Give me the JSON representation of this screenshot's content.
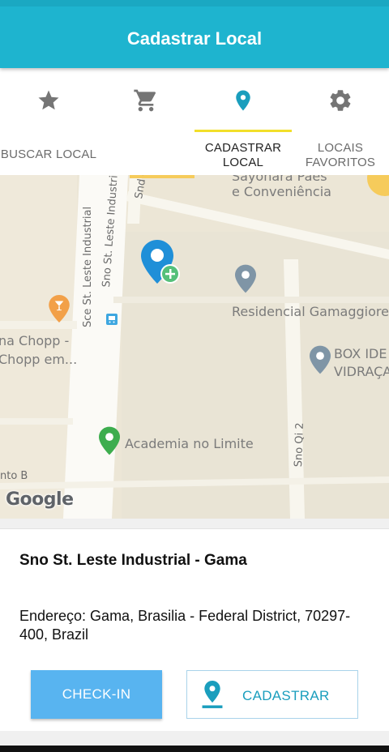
{
  "app_bar": {
    "title": "Cadastrar Local"
  },
  "tabs": [
    {
      "label": "BUSCAR LOCAL",
      "icon": "star-icon",
      "active": false
    },
    {
      "label": "CADASTRAR LOCAL",
      "icon": "cart-icon",
      "active": true
    },
    {
      "label": "LOCAIS FAVORITOS",
      "icon": "location-pin-icon",
      "active": false
    },
    {
      "label": "",
      "icon": "gear-icon",
      "active": false
    }
  ],
  "tab_labels": {
    "buscar": "BUSCAR LOCAL",
    "cadastrar_line1": "CADASTRAR",
    "cadastrar_line2": "LOCAL",
    "favoritos_line1": "LOCAIS",
    "favoritos_line2": "FAVORITOS"
  },
  "map": {
    "labels": {
      "conveniencia_top": "Sayonara Pães",
      "conveniencia": "e Conveniência",
      "residencial": "Residencial Gamaggiore",
      "chopp_line1": "na Chopp -",
      "chopp_line2": "Chopp em...",
      "box_line1": "BOX IDE",
      "box_line2": "VIDRAÇA",
      "academia": "Academia no Limite",
      "road_sce": "Sce St. Leste Industrial",
      "road_sno": "Sno St. Leste Industria",
      "road_qi2": "Sno Qi 2",
      "road_snd": "Snd Q",
      "partial_b": "nto B"
    },
    "attribution": "Google"
  },
  "place": {
    "name": "Sno St. Leste Industrial - Gama",
    "address": "Endereço: Gama, Brasilia - Federal District, 70297-400, Brazil"
  },
  "actions": {
    "checkin_label": "CHECK-IN",
    "cadastrar_label": "CADASTRAR"
  },
  "colors": {
    "app_bar": "#1eb4cf",
    "tab_indicator": "#f2df2a",
    "active_icon": "#1a9ebd",
    "checkin_button": "#58b4f0"
  }
}
